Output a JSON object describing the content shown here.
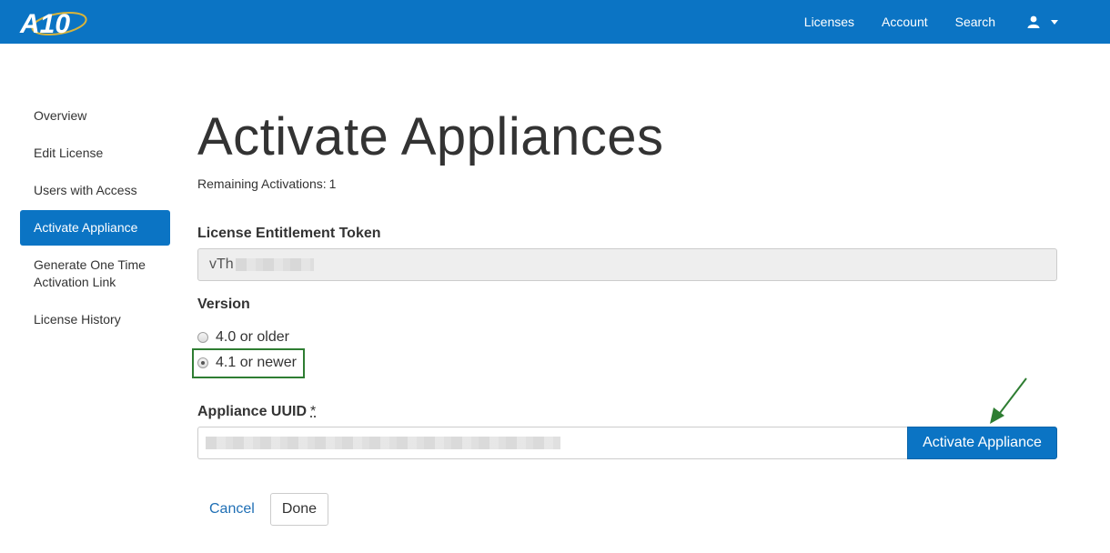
{
  "header": {
    "logo_text": "A10",
    "nav": [
      {
        "label": "Licenses"
      },
      {
        "label": "Account"
      },
      {
        "label": "Search"
      }
    ],
    "user_icon": "user-icon"
  },
  "sidebar": {
    "items": [
      {
        "label": "Overview"
      },
      {
        "label": "Edit License"
      },
      {
        "label": "Users with Access"
      },
      {
        "label": "Activate Appliance",
        "active": true
      },
      {
        "label": "Generate One Time Activation Link"
      },
      {
        "label": "License History"
      }
    ]
  },
  "main": {
    "title": "Activate Appliances",
    "remaining_label": "Remaining Activations:",
    "remaining_count": "1",
    "token_label": "License Entitlement Token",
    "token_value": "vTh",
    "version_label": "Version",
    "version_options": [
      {
        "label": "4.0 or older",
        "checked": false
      },
      {
        "label": "4.1 or newer",
        "checked": true
      }
    ],
    "uuid_label": "Appliance UUID",
    "uuid_required_mark": "*",
    "activate_button": "Activate Appliance",
    "cancel_label": "Cancel",
    "done_label": "Done"
  },
  "colors": {
    "brand": "#0b74c4",
    "highlight": "#2e7d32",
    "link": "#1f6fb5"
  }
}
